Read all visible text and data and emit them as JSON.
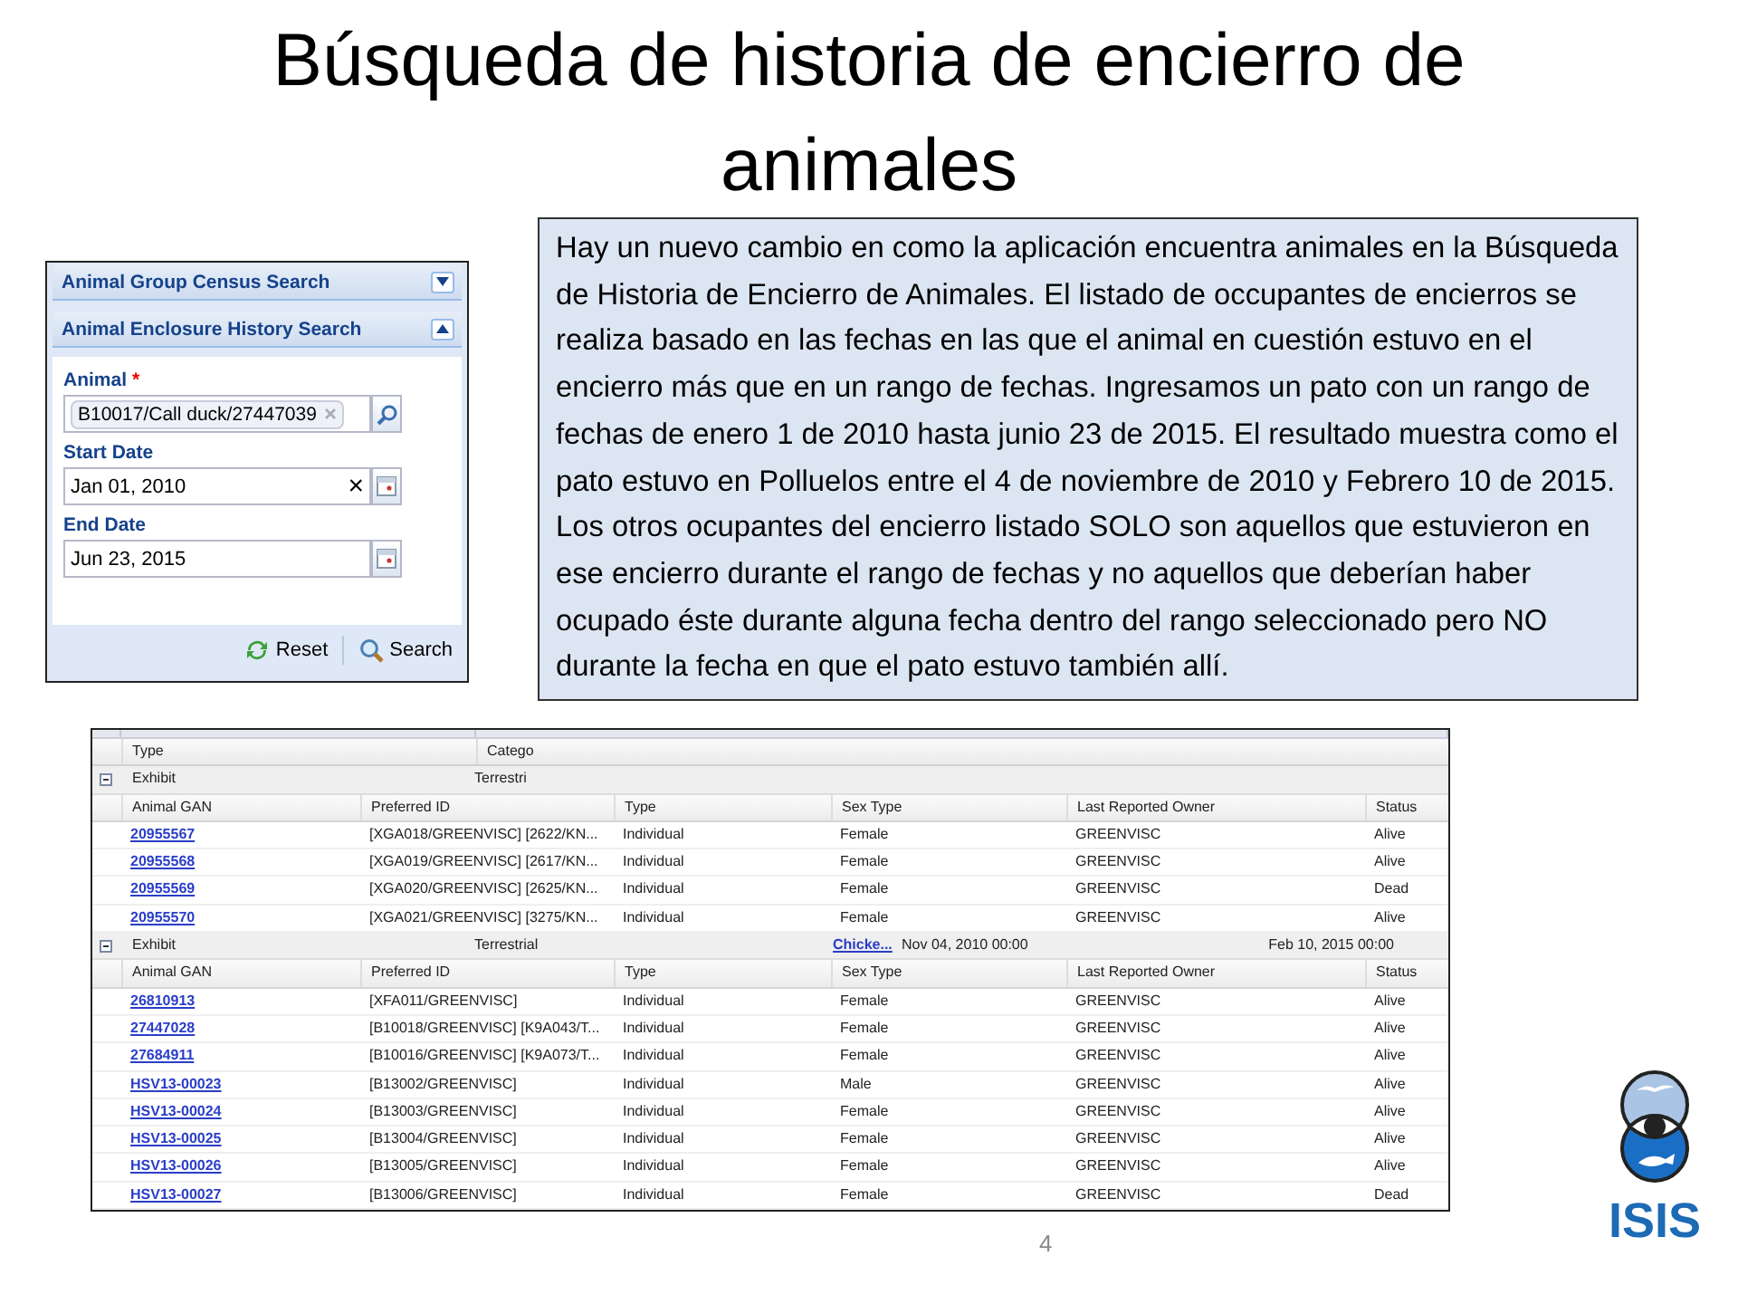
{
  "title": "Búsqueda de historia de encierro de animales",
  "search_panel": {
    "sections": [
      {
        "title": "Animal Group Census Search",
        "expanded": false
      },
      {
        "title": "Animal Enclosure History Search",
        "expanded": true
      }
    ],
    "fields": [
      {
        "kind": "lookup",
        "label": "Animal",
        "required_mark": "*",
        "value": "B10017/Call duck/27447039"
      },
      {
        "kind": "date",
        "label": "Start Date",
        "value": "Jan 01, 2010",
        "clear": "×"
      },
      {
        "kind": "date",
        "label": "End Date",
        "value": "Jun 23, 2015"
      }
    ],
    "buttons": [
      {
        "kind": "reset",
        "label": "Reset"
      },
      {
        "kind": "search",
        "label": "Search"
      }
    ]
  },
  "grid": {
    "top_columns": [
      "Type",
      "Catego"
    ],
    "groups": [
      {
        "expanded": true,
        "type": "Exhibit",
        "category": "Terrestri",
        "columns": [
          "Animal GAN",
          "Preferred ID",
          "Type",
          "Sex Type",
          "Last Reported Owner",
          "Status"
        ],
        "rows": [
          [
            "20955567",
            "[XGA018/GREENVISC] [2622/KN...",
            "Individual",
            "Female",
            "GREENVISC",
            "Alive"
          ],
          [
            "20955568",
            "[XGA019/GREENVISC] [2617/KN...",
            "Individual",
            "Female",
            "GREENVISC",
            "Alive"
          ],
          [
            "20955569",
            "[XGA020/GREENVISC] [2625/KN...",
            "Individual",
            "Female",
            "GREENVISC",
            "Dead"
          ],
          [
            "20955570",
            "[XGA021/GREENVISC] [3275/KN...",
            "Individual",
            "Female",
            "GREENVISC",
            "Alive"
          ]
        ]
      },
      {
        "expanded": true,
        "type": "Exhibit",
        "category": "Terrestrial",
        "link": "Chicke...",
        "start": "Nov 04, 2010 00:00",
        "end": "Feb 10, 2015 00:00",
        "columns": [
          "Animal GAN",
          "Preferred ID",
          "Type",
          "Sex Type",
          "Last Reported Owner",
          "Status"
        ],
        "rows": [
          [
            "26810913",
            "[XFA011/GREENVISC]",
            "Individual",
            "Female",
            "GREENVISC",
            "Alive"
          ],
          [
            "27447028",
            "[B10018/GREENVISC] [K9A043/T...",
            "Individual",
            "Female",
            "GREENVISC",
            "Alive"
          ],
          [
            "27684911",
            "[B10016/GREENVISC] [K9A073/T...",
            "Individual",
            "Female",
            "GREENVISC",
            "Alive"
          ],
          [
            "HSV13-00023",
            "[B13002/GREENVISC]",
            "Individual",
            "Male",
            "GREENVISC",
            "Alive"
          ],
          [
            "HSV13-00024",
            "[B13003/GREENVISC]",
            "Individual",
            "Female",
            "GREENVISC",
            "Alive"
          ],
          [
            "HSV13-00025",
            "[B13004/GREENVISC]",
            "Individual",
            "Female",
            "GREENVISC",
            "Alive"
          ],
          [
            "HSV13-00026",
            "[B13005/GREENVISC]",
            "Individual",
            "Female",
            "GREENVISC",
            "Alive"
          ],
          [
            "HSV13-00027",
            "[B13006/GREENVISC]",
            "Individual",
            "Female",
            "GREENVISC",
            "Dead"
          ]
        ]
      }
    ]
  },
  "callout": "Hay un nuevo cambio en como la aplicación encuentra animales en la Búsqueda de Historia de Encierro de Animales. El listado de occupantes de encierros se realiza basado en las fechas en las que el animal en cuestión estuvo en el encierro más que en un rango de fechas. Ingresamos un pato con un rango de fechas de enero 1 de 2010 hasta junio 23 de 2015. El resultado muestra como el pato estuvo en Polluelos entre el 4 de noviembre de 2010 y Febrero 10 de 2015. Los otros ocupantes del encierro listado SOLO son aquellos que estuvieron en ese encierro durante el rango de fechas y no aquellos que deberían haber ocupado éste durante alguna fecha dentro del rango seleccionado pero NO durante la fecha en que el pato estuvo también allí.",
  "logo": {
    "text": "ISIS"
  },
  "page_number": "4"
}
